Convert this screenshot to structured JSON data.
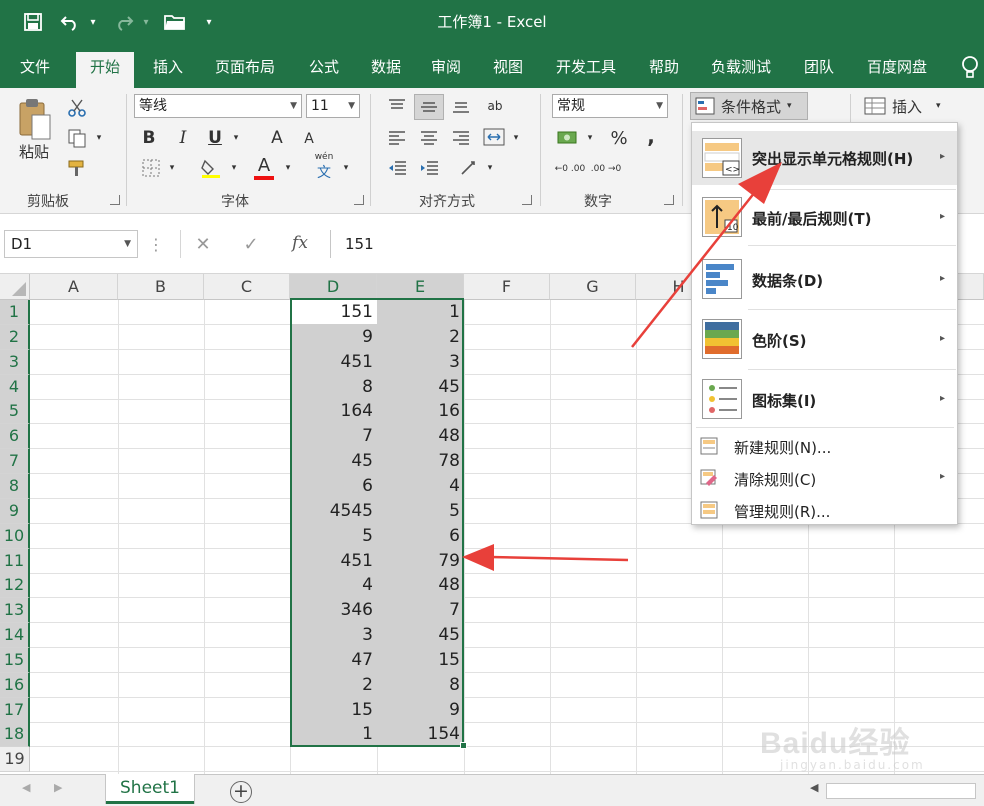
{
  "title_bar": {
    "title": "工作簿1 - Excel"
  },
  "menu": {
    "tabs": [
      "文件",
      "开始",
      "插入",
      "页面布局",
      "公式",
      "数据",
      "审阅",
      "视图",
      "开发工具",
      "帮助",
      "负载测试",
      "团队",
      "百度网盘"
    ],
    "active": "开始"
  },
  "ribbon": {
    "clipboard": {
      "paste": "粘贴",
      "label": "剪贴板"
    },
    "font": {
      "name": "等线",
      "size": "11",
      "bold": "B",
      "italic": "I",
      "underline": "U",
      "grow": "A",
      "shrink": "A",
      "font_color": "A",
      "phonetic": "wén",
      "label": "字体"
    },
    "alignment": {
      "label": "对齐方式",
      "wrap": "ab"
    },
    "number": {
      "format": "常规",
      "percent": "%",
      "comma": ",",
      "inc_decimal": "←0 .00",
      "dec_decimal": ".00 →0",
      "label": "数字"
    },
    "styles": {
      "conditional_formatting": "条件格式"
    },
    "cells": {
      "insert": "插入"
    }
  },
  "formula_bar": {
    "name_box": "D1",
    "fx": "fx",
    "value": "151"
  },
  "grid": {
    "columns": [
      "A",
      "B",
      "C",
      "D",
      "E",
      "F",
      "G",
      "H"
    ],
    "rows": [
      "1",
      "2",
      "3",
      "4",
      "5",
      "6",
      "7",
      "8",
      "9",
      "10",
      "11",
      "12",
      "13",
      "14",
      "15",
      "16",
      "17",
      "18",
      "19"
    ],
    "col_d": [
      "151",
      "9",
      "451",
      "8",
      "164",
      "7",
      "45",
      "6",
      "4545",
      "5",
      "451",
      "4",
      "346",
      "3",
      "47",
      "2",
      "15",
      "1"
    ],
    "col_e": [
      "1",
      "2",
      "3",
      "45",
      "16",
      "48",
      "78",
      "4",
      "5",
      "6",
      "79",
      "48",
      "7",
      "45",
      "15",
      "8",
      "9",
      "154"
    ]
  },
  "conditional_menu": {
    "items": [
      {
        "label": "突出显示单元格规则(H)",
        "mnemonic": "H",
        "arrow": "▸"
      },
      {
        "label": "最前/最后规则(T)",
        "mnemonic": "T",
        "arrow": "▸"
      },
      {
        "label": "数据条(D)",
        "mnemonic": "D",
        "arrow": "▸"
      },
      {
        "label": "色阶(S)",
        "mnemonic": "S",
        "arrow": "▸"
      },
      {
        "label": "图标集(I)",
        "mnemonic": "I",
        "arrow": "▸"
      }
    ],
    "small_items": [
      {
        "label": "新建规则(N)...",
        "arrow": ""
      },
      {
        "label": "清除规则(C)",
        "arrow": "▸"
      },
      {
        "label": "管理规则(R)...",
        "arrow": ""
      }
    ]
  },
  "sheets": {
    "tabs": [
      "Sheet1"
    ],
    "add": "+"
  },
  "watermark": {
    "text": "Baidu经验",
    "url": "jingyan.baidu.com"
  },
  "colors": {
    "excel_green": "#217346",
    "arrow_red": "#e8403a",
    "selection": "#d0d0d0"
  }
}
